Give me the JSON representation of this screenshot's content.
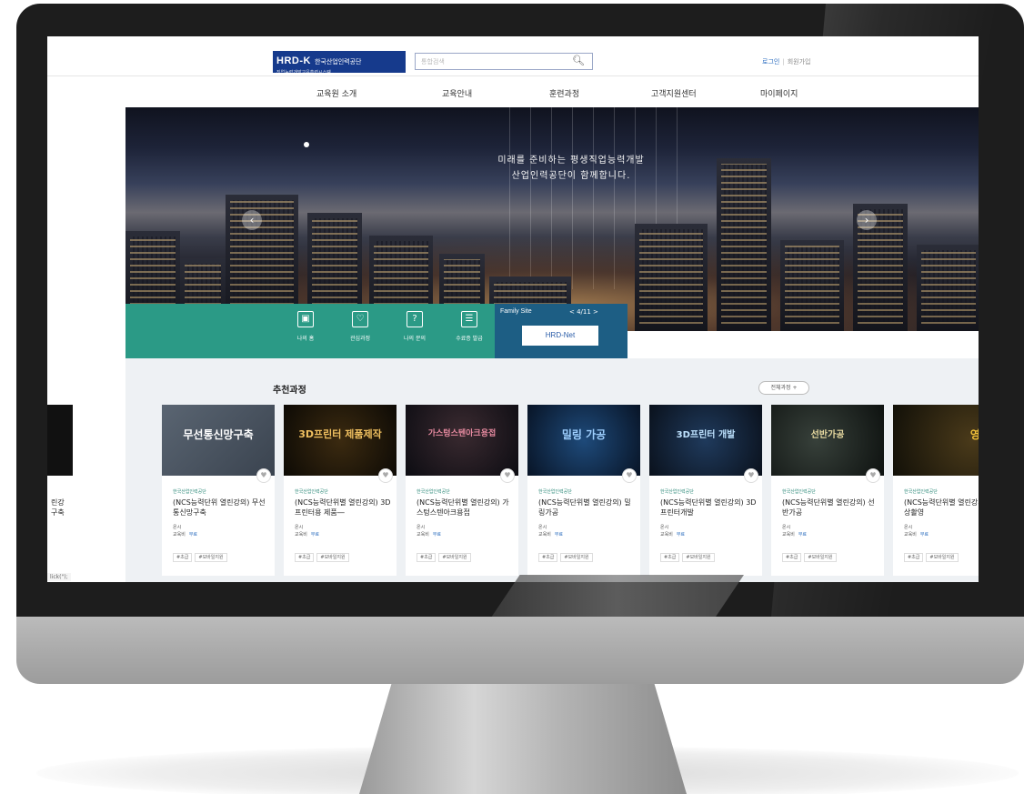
{
  "header": {
    "logo_brand": "HRD-K",
    "logo_name": "한국산업인력공단",
    "logo_sub": "직업능력개발교육훈련시스템",
    "search_placeholder": "통합검색",
    "login": "로그인",
    "join": "회원가입"
  },
  "nav": [
    "교육원 소개",
    "교육안내",
    "훈련과정",
    "고객지원센터",
    "마이페이지"
  ],
  "hero": {
    "line1": "미래를 준비하는 평생직업능력개발",
    "line2": "산업인력공단이 함께합니다."
  },
  "quick_menu": [
    {
      "label": "나의 홈",
      "icon": "home-monitor-icon"
    },
    {
      "label": "관심과정",
      "icon": "heart-doc-icon"
    },
    {
      "label": "나의 문의",
      "icon": "question-icon"
    },
    {
      "label": "수료증 발급",
      "icon": "certificate-icon"
    }
  ],
  "family_site": {
    "title": "Family Site",
    "pager": "< 4/11 >",
    "card": "HRD-Net"
  },
  "recommend": {
    "title": "추천과정",
    "all_button": "전체과정 +",
    "cards": [
      {
        "thumb": "무선통신망구축",
        "org": "한국산업인력공단",
        "name": "(NCS능력단위 열린강의) 무선통신망구축",
        "type": "온시",
        "fee_label": "교육비",
        "fee": "무료",
        "tags": [
          "#초급",
          "#모바일지원"
        ]
      },
      {
        "thumb": "3D프린터 제품제작",
        "org": "한국산업인력공단",
        "name": "(NCS능력단위별 열린강의) 3D프린터용 제품―",
        "type": "온시",
        "fee_label": "교육비",
        "fee": "무료",
        "tags": [
          "#초급",
          "#모바일지원"
        ]
      },
      {
        "thumb": "가스텅스텐아크용접",
        "org": "한국산업인력공단",
        "name": "(NCS능력단위별 열린강의) 가스텅스텐아크용접",
        "type": "온시",
        "fee_label": "교육비",
        "fee": "무료",
        "tags": [
          "#초급",
          "#모바일지원"
        ]
      },
      {
        "thumb": "밀링 가공",
        "org": "한국산업인력공단",
        "name": "(NCS능력단위별 열린강의) 밀링가공",
        "type": "온시",
        "fee_label": "교육비",
        "fee": "무료",
        "tags": [
          "#초급",
          "#모바일지원"
        ]
      },
      {
        "thumb": "3D프린터 개발",
        "org": "한국산업인력공단",
        "name": "(NCS능력단위별 열린강의) 3D프린터개발",
        "type": "온시",
        "fee_label": "교육비",
        "fee": "무료",
        "tags": [
          "#초급",
          "#모바일지원"
        ]
      },
      {
        "thumb": "선반가공",
        "org": "한국산업인력공단",
        "name": "(NCS능력단위별 열린강의) 선반가공",
        "type": "온시",
        "fee_label": "교육비",
        "fee": "무료",
        "tags": [
          "#초급",
          "#모바일지원"
        ]
      },
      {
        "thumb": "영상촬",
        "org": "한국산업인력공단",
        "name": "(NCS능력단위별 열린강의) 영상촬영",
        "type": "온시",
        "fee_label": "교육비",
        "fee": "무료",
        "tags": [
          "#초급",
          "#모바일지원"
        ]
      }
    ],
    "partial_left": {
      "name": "린강 구축"
    }
  },
  "status_bar": "lick(\");",
  "colors": {
    "teal": "#2b9a86",
    "navy": "#1d5e84",
    "logo": "#163a8c",
    "link": "#2e6fc0"
  }
}
